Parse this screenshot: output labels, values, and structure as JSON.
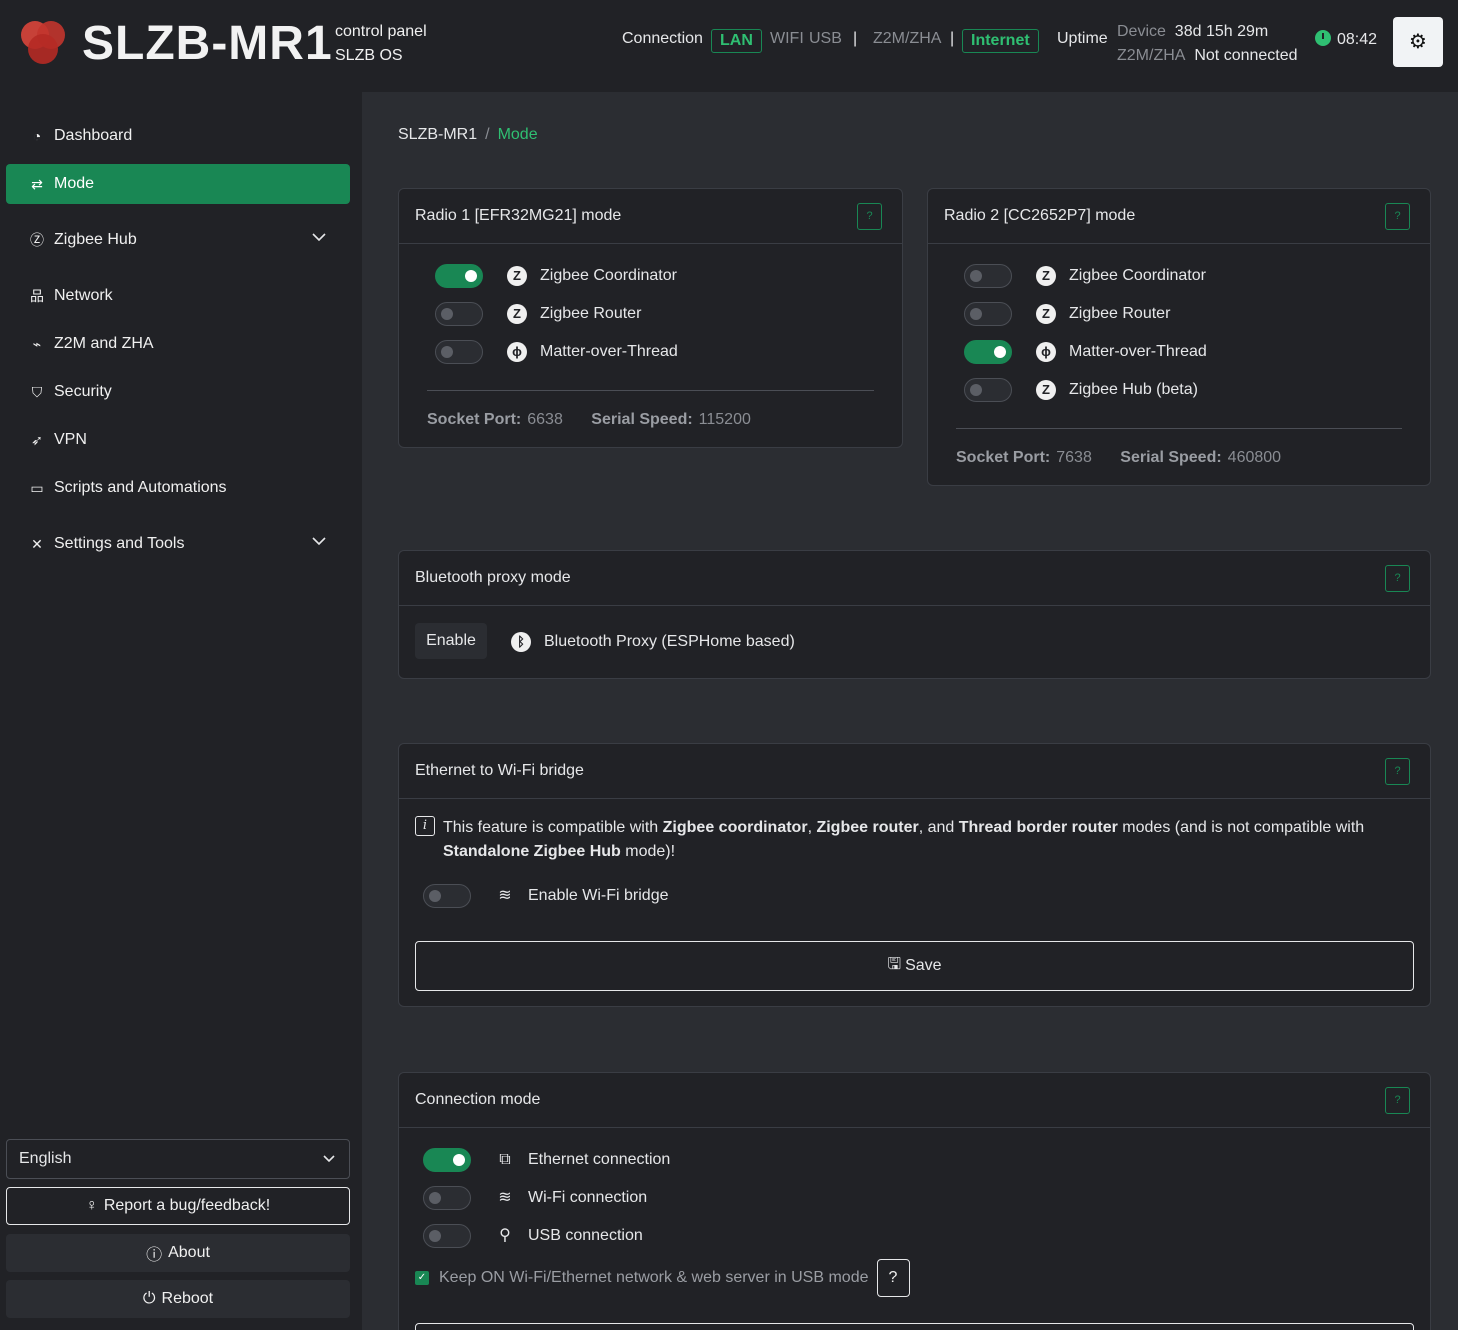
{
  "header": {
    "brand": "SLZB-MR1",
    "subtitle_line1": "control panel",
    "subtitle_line2": "SLZB OS",
    "connection_label": "Connection",
    "lan": "LAN",
    "wifi": "WIFI",
    "usb": "USB",
    "sep1": "|",
    "z2m_zha": "Z2M/ZHA",
    "sep2": "|",
    "internet": "Internet",
    "uptime_label": "Uptime",
    "device_label": "Device",
    "device_uptime": "38d 15h 29m",
    "z2m_label": "Z2M/ZHA",
    "z2m_status": "Not connected",
    "time": "08:42",
    "theme_icon": "gear-icon"
  },
  "sidebar": {
    "items": [
      {
        "label": "Dashboard",
        "icon": "dashboard-icon"
      },
      {
        "label": "Mode",
        "icon": "swap-arrows-icon"
      },
      {
        "label": "Zigbee Hub",
        "icon": "zigbee-icon"
      },
      {
        "label": "Network",
        "icon": "network-icon"
      },
      {
        "label": "Z2M and ZHA",
        "icon": "satellite-icon"
      },
      {
        "label": "Security",
        "icon": "shield-icon"
      },
      {
        "label": "VPN",
        "icon": "rocket-icon"
      },
      {
        "label": "Scripts and Automations",
        "icon": "terminal-icon"
      },
      {
        "label": "Settings and Tools",
        "icon": "tools-icon"
      }
    ],
    "language": "English",
    "report_bug": "Report a bug/feedback!",
    "about": "About",
    "reboot": "Reboot"
  },
  "breadcrumb": {
    "root": "SLZB-MR1",
    "sep": "/",
    "current": "Mode"
  },
  "radio1": {
    "title": "Radio 1 [EFR32MG21] mode",
    "help": "?",
    "options": [
      {
        "label": "Zigbee Coordinator",
        "on": true
      },
      {
        "label": "Zigbee Router",
        "on": false
      },
      {
        "label": "Matter-over-Thread",
        "on": false
      }
    ],
    "socket_port_label": "Socket Port:",
    "socket_port": "6638",
    "serial_speed_label": "Serial Speed:",
    "serial_speed": "115200"
  },
  "radio2": {
    "title": "Radio 2 [CC2652P7] mode",
    "help": "?",
    "options": [
      {
        "label": "Zigbee Coordinator",
        "on": false
      },
      {
        "label": "Zigbee Router",
        "on": false
      },
      {
        "label": "Matter-over-Thread",
        "on": true
      },
      {
        "label": "Zigbee Hub (beta)",
        "on": false
      }
    ],
    "socket_port_label": "Socket Port:",
    "socket_port": "7638",
    "serial_speed_label": "Serial Speed:",
    "serial_speed": "460800"
  },
  "bluetooth": {
    "title": "Bluetooth proxy mode",
    "help": "?",
    "enable_label": "Enable",
    "proxy_label": "Bluetooth Proxy (ESPHome based)"
  },
  "bridge": {
    "title": "Ethernet to Wi-Fi bridge",
    "help": "?",
    "info_1": "This feature is compatible with ",
    "info_b1": "Zigbee coordinator",
    "info_2": ", ",
    "info_b2": "Zigbee router",
    "info_3": ", and ",
    "info_b3": "Thread border router",
    "info_4": " modes (and is not compatible with ",
    "info_b4": "Standalone Zigbee Hub",
    "info_5": " mode)!",
    "toggle_label": "Enable Wi-Fi bridge",
    "toggle_on": false,
    "save_label": "Save"
  },
  "connection_mode": {
    "title": "Connection mode",
    "help": "?",
    "options": [
      {
        "label": "Ethernet connection",
        "on": true
      },
      {
        "label": "Wi-Fi connection",
        "on": false
      },
      {
        "label": "USB connection",
        "on": false
      }
    ],
    "keep_on_label": "Keep ON Wi-Fi/Ethernet network & web server in USB mode",
    "keep_on_checked": true,
    "keep_on_help": "?"
  },
  "colors": {
    "accent": "#198754",
    "accent_text": "#2fbf72",
    "background": "#2b2d32",
    "panel": "#212226"
  }
}
